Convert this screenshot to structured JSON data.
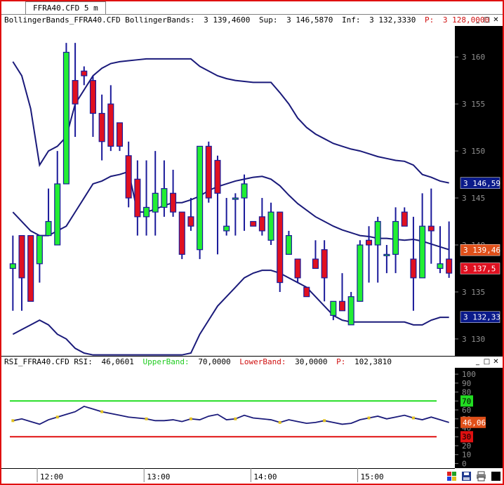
{
  "tab": {
    "label": "FFRA40.CFD 5 m"
  },
  "price_header": {
    "indicator": "BollingerBands_FFRA40.CFD BollingerBands:",
    "value": "3 139,4600",
    "sup_label": "Sup:",
    "sup_value": "3 146,5870",
    "inf_label": "Inf:",
    "inf_value": "3 132,3330",
    "p_label": "P:",
    "p_value": "3 128,0000",
    "p_color": "#d01010"
  },
  "rsi_header": {
    "indicator": "RSI_FFRA40.CFD RSI:",
    "value": "46,0601",
    "upper_label": "UpperBand:",
    "upper_value": "70,0000",
    "upper_color": "#22cc22",
    "lower_label": "LowerBand:",
    "lower_value": "30,0000",
    "lower_color": "#d01010",
    "p_label": "P:",
    "p_value": "102,3810"
  },
  "window_buttons": {
    "minimize": "_",
    "restore": "□",
    "close": "✕"
  },
  "chart_data": [
    {
      "type": "candlestick",
      "title": "",
      "ylim": [
        3128.5,
        3163
      ],
      "yticks": [
        3130,
        3135,
        3140,
        3145,
        3150,
        3155,
        3160
      ],
      "ytick_labels": [
        "3 130",
        "3 135",
        "3 140",
        "3 145",
        "3 150",
        "3 155",
        "3 160"
      ],
      "up_color": "#22ee33",
      "down_color": "#e01020",
      "band_color": "#1a1a7a",
      "x_labels": [
        {
          "index": 4,
          "label": "12:00"
        },
        {
          "index": 16,
          "label": "13:00"
        },
        {
          "index": 28,
          "label": "14:00"
        },
        {
          "index": 40,
          "label": "15:00"
        }
      ],
      "candles": [
        {
          "o": 3137.5,
          "h": 3141,
          "l": 3133,
          "c": 3138
        },
        {
          "o": 3141,
          "h": 3141,
          "l": 3133,
          "c": 3136.5
        },
        {
          "o": 3141,
          "h": 3141,
          "l": 3134,
          "c": 3134
        },
        {
          "o": 3138,
          "h": 3141,
          "l": 3136,
          "c": 3141
        },
        {
          "o": 3141,
          "h": 3146,
          "l": 3141,
          "c": 3142.5
        },
        {
          "o": 3140,
          "h": 3150,
          "l": 3140,
          "c": 3146.5
        },
        {
          "o": 3146.5,
          "h": 3161.5,
          "l": 3146.5,
          "c": 3160.5
        },
        {
          "o": 3157.5,
          "h": 3161.5,
          "l": 3151.5,
          "c": 3155
        },
        {
          "o": 3158.5,
          "h": 3159,
          "l": 3157,
          "c": 3158
        },
        {
          "o": 3157.5,
          "h": 3158,
          "l": 3151.5,
          "c": 3154
        },
        {
          "o": 3154,
          "h": 3156,
          "l": 3149,
          "c": 3151
        },
        {
          "o": 3155,
          "h": 3157,
          "l": 3150,
          "c": 3150.5
        },
        {
          "o": 3153,
          "h": 3153,
          "l": 3150,
          "c": 3150.5
        },
        {
          "o": 3149.5,
          "h": 3151,
          "l": 3144,
          "c": 3145
        },
        {
          "o": 3147,
          "h": 3149,
          "l": 3141,
          "c": 3143
        },
        {
          "o": 3143,
          "h": 3149,
          "l": 3141,
          "c": 3144
        },
        {
          "o": 3143.5,
          "h": 3150,
          "l": 3141,
          "c": 3145.5
        },
        {
          "o": 3144,
          "h": 3149,
          "l": 3143,
          "c": 3146
        },
        {
          "o": 3145.5,
          "h": 3148,
          "l": 3143,
          "c": 3143.5
        },
        {
          "o": 3143.5,
          "h": 3143.5,
          "l": 3138.5,
          "c": 3139
        },
        {
          "o": 3143,
          "h": 3145,
          "l": 3141.5,
          "c": 3142
        },
        {
          "o": 3139.5,
          "h": 3150.5,
          "l": 3138.5,
          "c": 3150.5
        },
        {
          "o": 3150.5,
          "h": 3151,
          "l": 3144.5,
          "c": 3145
        },
        {
          "o": 3149,
          "h": 3149.5,
          "l": 3139,
          "c": 3145.5
        },
        {
          "o": 3141.5,
          "h": 3145,
          "l": 3141,
          "c": 3142
        },
        {
          "o": 3145,
          "h": 3145.5,
          "l": 3141,
          "c": 3145
        },
        {
          "o": 3145,
          "h": 3147.5,
          "l": 3141.5,
          "c": 3146.5
        },
        {
          "o": 3142.5,
          "h": 3142.5,
          "l": 3142,
          "c": 3142
        },
        {
          "o": 3143,
          "h": 3145,
          "l": 3141,
          "c": 3141.5
        },
        {
          "o": 3140.5,
          "h": 3144.5,
          "l": 3140,
          "c": 3143.5
        },
        {
          "o": 3143.5,
          "h": 3143.5,
          "l": 3135,
          "c": 3136
        },
        {
          "o": 3139,
          "h": 3141.5,
          "l": 3139,
          "c": 3141
        },
        {
          "o": 3138.5,
          "h": 3138.5,
          "l": 3136,
          "c": 3136.5
        },
        {
          "o": 3135.5,
          "h": 3135.5,
          "l": 3134.5,
          "c": 3134.5
        },
        {
          "o": 3138.5,
          "h": 3140.5,
          "l": 3137.5,
          "c": 3137.5
        },
        {
          "o": 3139.5,
          "h": 3140.5,
          "l": 3134,
          "c": 3136.5
        },
        {
          "o": 3132.5,
          "h": 3134,
          "l": 3132,
          "c": 3134
        },
        {
          "o": 3134,
          "h": 3137,
          "l": 3133,
          "c": 3133
        },
        {
          "o": 3131.5,
          "h": 3135,
          "l": 3131.5,
          "c": 3134.5
        },
        {
          "o": 3134,
          "h": 3140.5,
          "l": 3134,
          "c": 3140
        },
        {
          "o": 3140.5,
          "h": 3142,
          "l": 3136,
          "c": 3140
        },
        {
          "o": 3140,
          "h": 3143,
          "l": 3136,
          "c": 3142.5
        },
        {
          "o": 3139,
          "h": 3140,
          "l": 3137,
          "c": 3139
        },
        {
          "o": 3139,
          "h": 3144,
          "l": 3137,
          "c": 3142.5
        },
        {
          "o": 3143.5,
          "h": 3144,
          "l": 3142,
          "c": 3142
        },
        {
          "o": 3138.5,
          "h": 3143,
          "l": 3133,
          "c": 3136.5
        },
        {
          "o": 3136.5,
          "h": 3145.5,
          "l": 3136.5,
          "c": 3142
        },
        {
          "o": 3142,
          "h": 3146,
          "l": 3138,
          "c": 3141.5
        },
        {
          "o": 3137.5,
          "h": 3142,
          "l": 3137,
          "c": 3138
        },
        {
          "o": 3138.5,
          "h": 3142.5,
          "l": 3136.5,
          "c": 3137
        }
      ],
      "series": [
        {
          "values": [
            3159.5,
            3158,
            3154.5,
            3148.5,
            3150,
            3150.5,
            3151.5,
            3155,
            3156.5,
            3158,
            3158.8,
            3159.3,
            3159.5,
            3159.6,
            3159.7,
            3159.8,
            3159.8,
            3159.8,
            3159.8,
            3159.8,
            3159.8,
            3159,
            3158.5,
            3158,
            3157.7,
            3157.5,
            3157.4,
            3157.3,
            3157.3,
            3157.3,
            3156.2,
            3155,
            3153.5,
            3152.5,
            3151.8,
            3151.3,
            3150.8,
            3150.5,
            3150.2,
            3150,
            3149.7,
            3149.4,
            3149.2,
            3149,
            3148.9,
            3148.5,
            3147.5,
            3147.2,
            3146.8,
            3146.6
          ]
        },
        {
          "values": [
            3143.5,
            3142.5,
            3141.5,
            3141,
            3141,
            3141.5,
            3142,
            3143.5,
            3145,
            3146.5,
            3146.8,
            3147.3,
            3147.5,
            3147.8,
            3143.5,
            3143.5,
            3143.8,
            3144.2,
            3144.5,
            3144.5,
            3144.8,
            3145.2,
            3145.8,
            3146.2,
            3146.5,
            3146.8,
            3147,
            3147.2,
            3147.3,
            3147,
            3146.3,
            3145.3,
            3144.4,
            3143.7,
            3143,
            3142.5,
            3142,
            3141.6,
            3141.3,
            3141,
            3140.9,
            3140.7,
            3140.7,
            3140.6,
            3140.5,
            3140.6,
            3140.4,
            3140.1,
            3139.8,
            3139.5
          ]
        },
        {
          "values": [
            3130.5,
            3131,
            3131.5,
            3132,
            3131.5,
            3130.5,
            3130,
            3129,
            3128.5,
            3128.3,
            3128.3,
            3128.3,
            3128.3,
            3128.3,
            3128.3,
            3128.3,
            3128.3,
            3128.3,
            3128.3,
            3128.3,
            3128.5,
            3130.5,
            3132,
            3133.5,
            3134.5,
            3135.5,
            3136.5,
            3137,
            3137.3,
            3137.3,
            3137,
            3136.5,
            3136,
            3135.5,
            3134.5,
            3133.5,
            3132.5,
            3132,
            3131.8,
            3131.8,
            3131.8,
            3131.8,
            3131.8,
            3131.8,
            3131.8,
            3131.5,
            3131.5,
            3132,
            3132.3,
            3132.3
          ]
        }
      ],
      "axis_badges": [
        {
          "label": "3 146,59",
          "value": 3146.59,
          "bg": "#0a1a8a",
          "fg": "#ffffff"
        },
        {
          "label": "3 139,46",
          "value": 3139.46,
          "bg": "#e0501a",
          "fg": "#ffffff"
        },
        {
          "label": "3 137,5",
          "value": 3137.5,
          "bg": "#e01020",
          "fg": "#ffffff"
        },
        {
          "label": "3 132,33",
          "value": 3132.33,
          "bg": "#0a1a8a",
          "fg": "#ffffff"
        }
      ]
    },
    {
      "type": "line",
      "title": "",
      "ylim": [
        -2,
        104
      ],
      "yticks": [
        0,
        10,
        20,
        30,
        40,
        50,
        60,
        70,
        80,
        90,
        100
      ],
      "ytick_labels": [
        "0",
        "10",
        "20",
        "30",
        "40",
        "50",
        "60",
        "70",
        "80",
        "90",
        "100"
      ],
      "levels": [
        {
          "value": 70,
          "color": "#22dd22",
          "badge": "70"
        },
        {
          "value": 30,
          "color": "#e01010",
          "badge": "30"
        }
      ],
      "series": [
        {
          "color": "#1a1a7a",
          "values": [
            48,
            50,
            47,
            44,
            49,
            52,
            55,
            58,
            64,
            61,
            58,
            56,
            54,
            52,
            51,
            50,
            48,
            48,
            49,
            47,
            50,
            49,
            53,
            55,
            49,
            50,
            54,
            51,
            50,
            49,
            46,
            49,
            47,
            45,
            46,
            48,
            46,
            44,
            45,
            49,
            51,
            53,
            50,
            52,
            54,
            51,
            49,
            52,
            49,
            46
          ]
        }
      ],
      "current": {
        "label": "46,06",
        "value": 46.06,
        "bg": "#e0501a"
      }
    }
  ]
}
